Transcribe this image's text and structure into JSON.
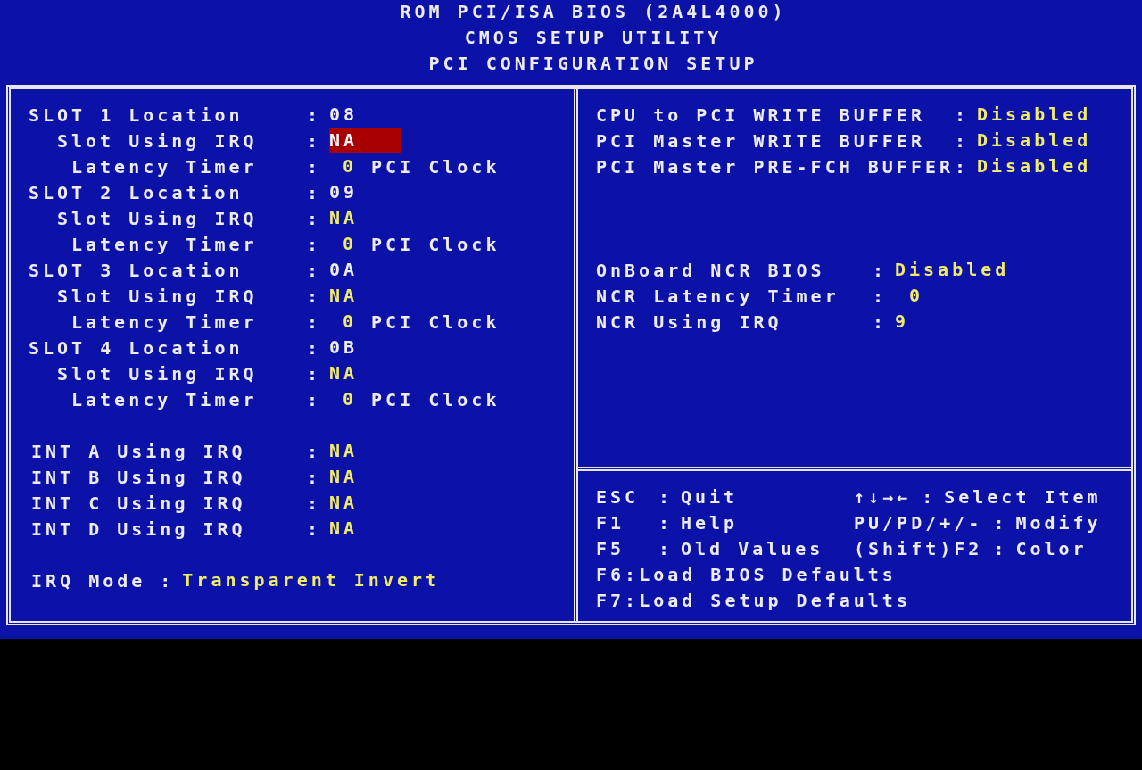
{
  "header": {
    "lines": [
      "ROM PCI/ISA BIOS (2A4L4000)",
      "CMOS SETUP UTILITY",
      "PCI CONFIGURATION SETUP"
    ]
  },
  "separator": ":",
  "slots": [
    {
      "kind": "location",
      "label": "SLOT 1 Location",
      "value": "08",
      "selected": false
    },
    {
      "kind": "irq",
      "label": "Slot Using IRQ",
      "value": "NA",
      "selected": true
    },
    {
      "kind": "latency",
      "label": "Latency Timer",
      "value": "0",
      "unit": "PCI Clock",
      "selected": false
    },
    {
      "kind": "location",
      "label": "SLOT 2 Location",
      "value": "09",
      "selected": false
    },
    {
      "kind": "irq",
      "label": "Slot Using IRQ",
      "value": "NA",
      "selected": false
    },
    {
      "kind": "latency",
      "label": "Latency Timer",
      "value": "0",
      "unit": "PCI Clock",
      "selected": false
    },
    {
      "kind": "location",
      "label": "SLOT 3 Location",
      "value": "0A",
      "selected": false
    },
    {
      "kind": "irq",
      "label": "Slot Using IRQ",
      "value": "NA",
      "selected": false
    },
    {
      "kind": "latency",
      "label": "Latency Timer",
      "value": "0",
      "unit": "PCI Clock",
      "selected": false
    },
    {
      "kind": "location",
      "label": "SLOT 4 Location",
      "value": "0B",
      "selected": false
    },
    {
      "kind": "irq",
      "label": "Slot Using IRQ",
      "value": "NA",
      "selected": false
    },
    {
      "kind": "latency",
      "label": "Latency Timer",
      "value": "0",
      "unit": "PCI Clock",
      "selected": false
    }
  ],
  "ints": [
    {
      "label": "INT A Using IRQ",
      "value": "NA",
      "selected": false
    },
    {
      "label": "INT B Using IRQ",
      "value": "NA",
      "selected": false
    },
    {
      "label": "INT C Using IRQ",
      "value": "NA",
      "selected": false
    },
    {
      "label": "INT D Using IRQ",
      "value": "NA",
      "selected": false
    }
  ],
  "irq_mode": {
    "label": "IRQ Mode",
    "value": "Transparent Invert",
    "selected": false
  },
  "buffers": [
    {
      "label": "CPU to PCI WRITE BUFFER",
      "value": "Disabled",
      "selected": false
    },
    {
      "label": "PCI Master WRITE BUFFER",
      "value": "Disabled",
      "selected": false
    },
    {
      "label": "PCI Master PRE-FCH BUFFER",
      "value": "Disabled",
      "selected": false
    }
  ],
  "ncr": [
    {
      "kind": "text",
      "label": "OnBoard NCR BIOS",
      "value": "Disabled",
      "selected": false
    },
    {
      "kind": "number",
      "label": "NCR Latency Timer",
      "value": "0",
      "selected": false
    },
    {
      "kind": "text",
      "label": "NCR Using IRQ",
      "value": "9",
      "selected": false
    }
  ],
  "help": [
    {
      "left": {
        "key": "ESC",
        "action": "Quit"
      },
      "right": {
        "key": "↑↓→←",
        "action": "Select Item"
      }
    },
    {
      "left": {
        "key": "F1",
        "action": "Help"
      },
      "right": {
        "key": "PU/PD/+/-",
        "action": "Modify"
      }
    },
    {
      "left": {
        "key": "F5",
        "action": "Old Values"
      },
      "right": {
        "key": "(Shift)F2",
        "action": "Color"
      }
    },
    {
      "left": {
        "key": "F6",
        "action": "Load BIOS Defaults"
      }
    },
    {
      "left": {
        "key": "F7",
        "action": "Load Setup Defaults"
      }
    }
  ]
}
